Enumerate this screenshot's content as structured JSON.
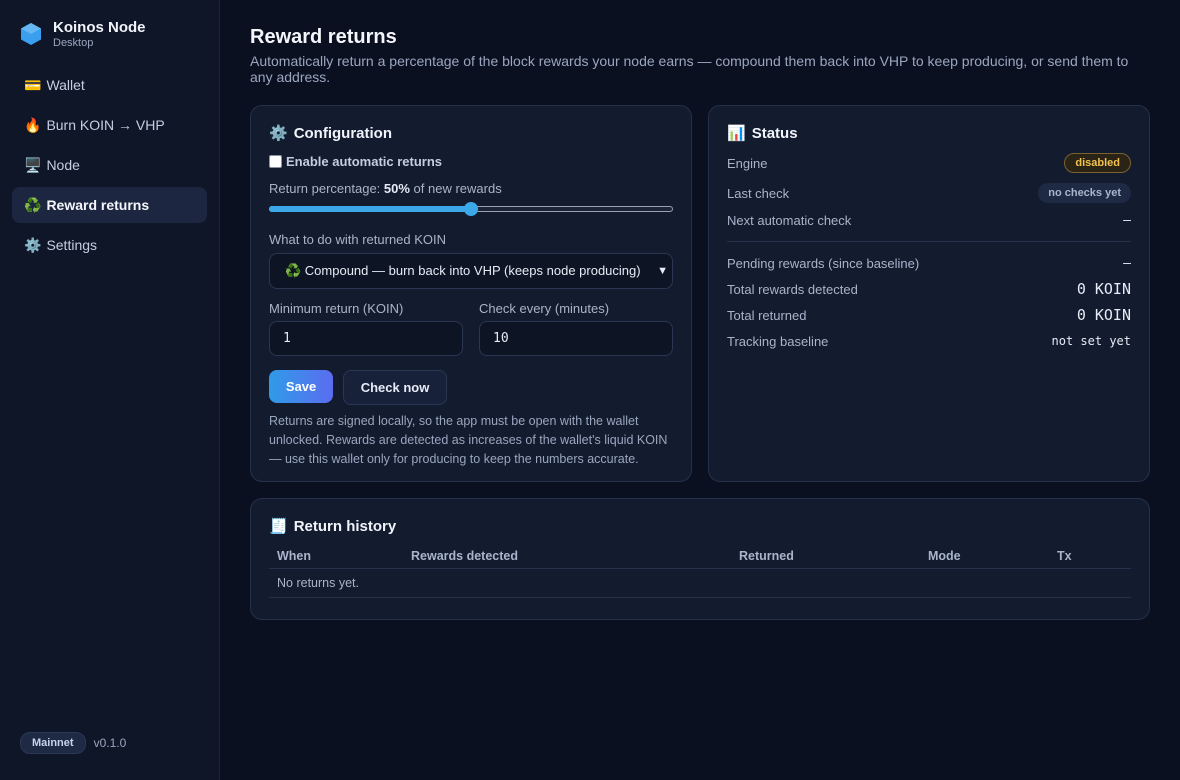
{
  "app": {
    "name": "Koinos Node",
    "subtitle": "Desktop",
    "network": "Mainnet",
    "version": "v0.1.0"
  },
  "sidebar": {
    "items": [
      {
        "emoji": "💳",
        "label": "Wallet"
      },
      {
        "emoji": "🔥",
        "label": "Burn KOIN → VHP"
      },
      {
        "emoji": "🖥️",
        "label": "Node"
      },
      {
        "emoji": "♻️",
        "label": "Reward returns"
      },
      {
        "emoji": "⚙️",
        "label": "Settings"
      }
    ]
  },
  "page": {
    "title": "Reward returns",
    "description": "Automatically return a percentage of the block rewards your node earns — compound them back into VHP to keep producing, or send them to any address."
  },
  "config": {
    "emoji": "⚙️",
    "title": "Configuration",
    "enable_label": "Enable automatic returns",
    "enabled": false,
    "percentage_prefix": "Return percentage: ",
    "percentage_value": "50%",
    "percentage_suffix": " of new rewards",
    "percentage_fraction": 0.5,
    "action_label": "What to do with returned KOIN",
    "action_value": "♻️ Compound — burn back into VHP (keeps node producing)",
    "min_label": "Minimum return (KOIN)",
    "min_value": "1",
    "interval_label": "Check every (minutes)",
    "interval_value": "10",
    "save_label": "Save",
    "check_label": "Check now",
    "note": "Returns are signed locally, so the app must be open with the wallet unlocked. Rewards are detected as increases of the wallet's liquid KOIN — use this wallet only for producing to keep the numbers accurate."
  },
  "status": {
    "emoji": "📊",
    "title": "Status",
    "engine_label": "Engine",
    "engine_value": "disabled",
    "last_check_label": "Last check",
    "last_check_value": "no checks yet",
    "next_check_label": "Next automatic check",
    "next_check_value": "–",
    "pending_label": "Pending rewards (since baseline)",
    "pending_value": "—",
    "total_detected_label": "Total rewards detected",
    "total_detected_value": "0 KOIN",
    "total_returned_label": "Total returned",
    "total_returned_value": "0 KOIN",
    "baseline_label": "Tracking baseline",
    "baseline_value": "not set yet"
  },
  "history": {
    "emoji": "🧾",
    "title": "Return history",
    "columns": [
      "When",
      "Rewards detected",
      "Returned",
      "Mode",
      "Tx"
    ],
    "empty": "No returns yet."
  },
  "colors": {
    "accent": "#3ba9e8",
    "warning": "#f2c14e",
    "background": "#0b1020",
    "card": "#131b2e"
  }
}
